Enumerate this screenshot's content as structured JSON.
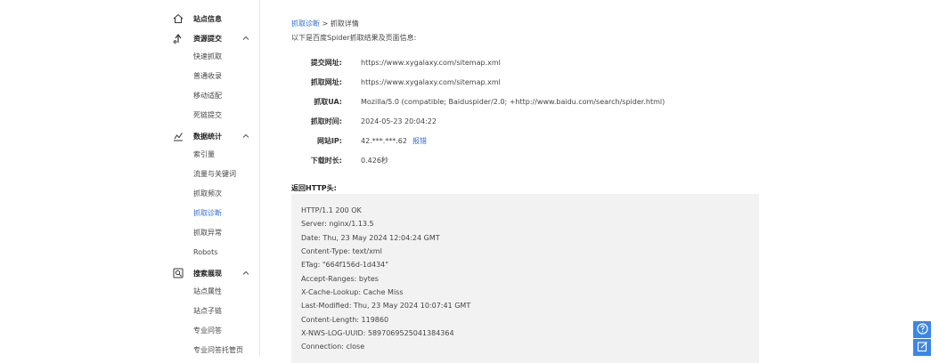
{
  "sidebar": {
    "groups": [
      {
        "label": "站点信息",
        "icon": "home-icon"
      },
      {
        "label": "资源提交",
        "icon": "upload-icon"
      },
      {
        "label": "数据统计",
        "icon": "chart-icon"
      },
      {
        "label": "搜索展现",
        "icon": "search-doc-icon"
      }
    ],
    "items": [
      {
        "label": "快速抓取"
      },
      {
        "label": "普通收录"
      },
      {
        "label": "移动适配"
      },
      {
        "label": "死链提交"
      },
      {
        "label": "索引量"
      },
      {
        "label": "流量与关键词"
      },
      {
        "label": "抓取频次"
      },
      {
        "label": "抓取诊断",
        "active": true
      },
      {
        "label": "抓取异常"
      },
      {
        "label": "Robots"
      },
      {
        "label": "站点属性"
      },
      {
        "label": "站点子链"
      },
      {
        "label": "专业问答"
      },
      {
        "label": "专业问答托管页"
      }
    ]
  },
  "breadcrumb": {
    "parent": "抓取诊断",
    "separator": ">",
    "current": "抓取详情"
  },
  "intro": "以下是百度Spider抓取结果及页面信息:",
  "details": [
    {
      "key": "提交网址:",
      "value": "https://www.xygalaxy.com/sitemap.xml"
    },
    {
      "key": "抓取网址:",
      "value": "https://www.xygalaxy.com/sitemap.xml"
    },
    {
      "key": "抓取UA:",
      "value": "Mozilla/5.0 (compatible; Baiduspider/2.0; +http://www.baidu.com/search/spider.html)"
    },
    {
      "key": "抓取时间:",
      "value": "2024-05-23 20:04:22"
    },
    {
      "key": "网站IP:",
      "value": "42.***.***.62",
      "link": "报错"
    },
    {
      "key": "下载时长:",
      "value": "0.426秒"
    }
  ],
  "http": {
    "title": "返回HTTP头:",
    "lines": [
      "HTTP/1.1 200 OK",
      "Server: nginx/1.13.5",
      "Date: Thu, 23 May 2024 12:04:24 GMT",
      "Content-Type: text/xml",
      "ETag: \"664f156d-1d434\"",
      "Accept-Ranges: bytes",
      "X-Cache-Lookup: Cache Miss",
      "Last-Modified: Thu, 23 May 2024 10:07:41 GMT",
      "Content-Length: 119860",
      "X-NWS-LOG-UUID: 5897069525041384364",
      "Connection: close"
    ]
  },
  "float_buttons": [
    {
      "icon": "help-icon"
    },
    {
      "icon": "feedback-icon"
    }
  ],
  "colors": {
    "accent": "#2d6fd6",
    "float": "#3a86e8",
    "box": "#f2f2f2"
  }
}
